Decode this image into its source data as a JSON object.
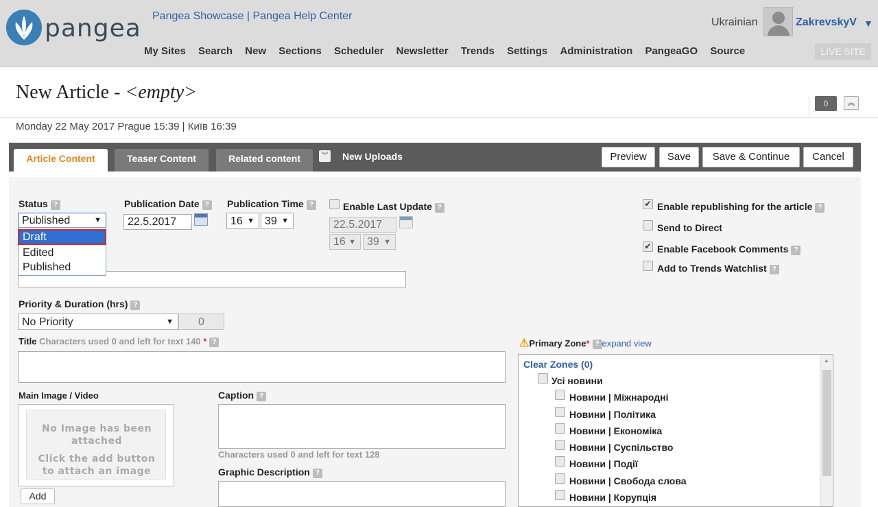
{
  "header": {
    "logo_text": "pangea",
    "top_links": [
      "Pangea Showcase",
      "Pangea Help Center"
    ],
    "top_links_separator": "|",
    "nav": [
      "My Sites",
      "Search",
      "New",
      "Sections",
      "Scheduler",
      "Newsletter",
      "Trends",
      "Settings",
      "Administration",
      "PangeaGO",
      "Source"
    ],
    "language": "Ukrainian",
    "username": "ZakrevskyV",
    "live_site": "LIVE SITE",
    "brand_color": "#3a7fb5",
    "link_color": "#2f5fa8"
  },
  "page": {
    "title_prefix": "New Article - ",
    "title_placeholder": "<empty>",
    "counter": "0",
    "datetime": "Monday 22 May 2017 Prague 15:39 | Київ 16:39"
  },
  "tabs": {
    "article": "Article Content",
    "teaser": "Teaser Content",
    "related": "Related content",
    "uploads": "New Uploads",
    "active_color": "#e08a1e"
  },
  "toolbar": {
    "preview": "Preview",
    "save": "Save",
    "save_continue": "Save & Continue",
    "cancel": "Cancel"
  },
  "form": {
    "status_label": "Status",
    "status_value": "Published",
    "status_options": [
      "Draft",
      "Edited",
      "Published"
    ],
    "status_highlighted": "Draft",
    "pub_date_label": "Publication Date",
    "pub_date": "22.5.2017",
    "pub_time_label": "Publication Time",
    "pub_hour": "16",
    "pub_minute": "39",
    "last_update_label": "Enable Last Update",
    "last_update_date": "22.5.2017",
    "last_update_hour": "16",
    "last_update_minute": "39",
    "priority_label": "Priority & Duration (hrs)",
    "priority_value": "No Priority",
    "duration": "0",
    "title_label": "Title",
    "title_hint": "Characters used 0 and left for text 140",
    "required_mark": "*",
    "main_image_label": "Main Image / Video",
    "no_image_text_1": "No Image has been attached",
    "no_image_text_2": "Click the add button to attach an image",
    "add_button": "Add",
    "caption_label": "Caption",
    "caption_hint": "Characters used 0 and left for text 128",
    "graphic_desc_label": "Graphic Description"
  },
  "options": {
    "republishing": {
      "label": "Enable republishing for the article",
      "checked": true
    },
    "send_direct": {
      "label": "Send to Direct",
      "checked": false
    },
    "facebook": {
      "label": "Enable Facebook Comments",
      "checked": true
    },
    "trends": {
      "label": "Add to Trends Watchlist",
      "checked": false
    }
  },
  "zones": {
    "label": "Primary Zone",
    "required_mark": "*",
    "expand_view": "expand view",
    "clear": "Clear Zones (0)",
    "root": "Усі новини",
    "items": [
      "Новини | Міжнародні",
      "Новини | Політика",
      "Новини | Економіка",
      "Новини | Суспільство",
      "Новини | Події",
      "Новини | Свобода слова",
      "Новини | Корупція"
    ]
  }
}
